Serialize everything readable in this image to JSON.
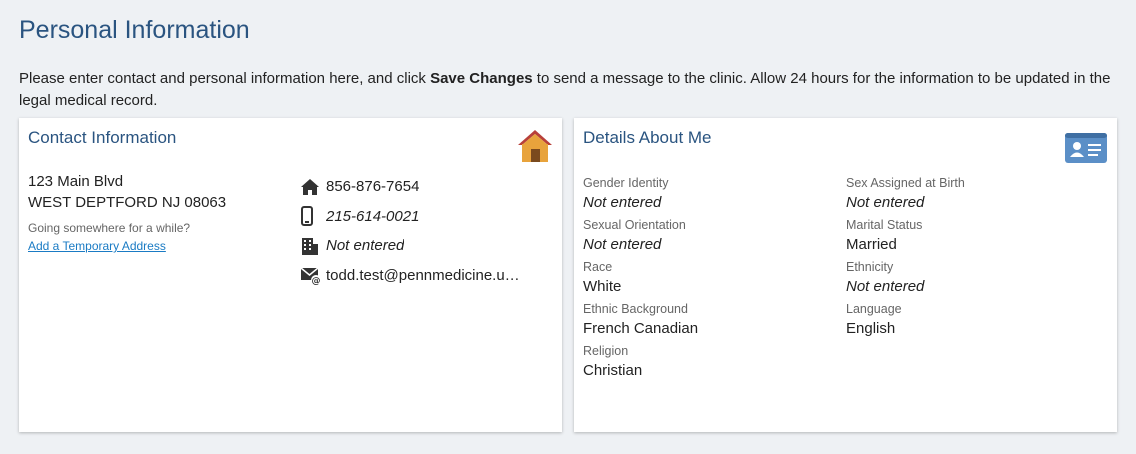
{
  "page": {
    "title": "Personal Information",
    "intro_before": "Please enter contact and personal information here, and click ",
    "intro_bold": "Save Changes",
    "intro_after": " to send a message to the clinic. Allow 24 hours for the information to be updated in the legal medical record."
  },
  "contact": {
    "title": "Contact Information",
    "icon": "house-icon",
    "address_line1": "123 Main Blvd",
    "address_line2": "WEST DEPTFORD NJ 08063",
    "going_text": "Going somewhere for a while?",
    "temp_address_link": "Add a Temporary Address",
    "items": [
      {
        "icon": "home-phone-icon",
        "value": "856-876-7654"
      },
      {
        "icon": "mobile-phone-icon",
        "value": "215-614-0021"
      },
      {
        "icon": "work-phone-icon",
        "value": "Not entered"
      },
      {
        "icon": "email-icon",
        "value": "todd.test@pennmedicine.u…"
      }
    ]
  },
  "details": {
    "title": "Details About Me",
    "icon": "id-card-icon",
    "fields": {
      "gender_identity": {
        "label": "Gender Identity",
        "value": "Not entered"
      },
      "sex_assigned": {
        "label": "Sex Assigned at Birth",
        "value": "Not entered"
      },
      "sexual_orientation": {
        "label": "Sexual Orientation",
        "value": "Not entered"
      },
      "marital_status": {
        "label": "Marital Status",
        "value": "Married"
      },
      "race": {
        "label": "Race",
        "value": "White"
      },
      "ethnicity": {
        "label": "Ethnicity",
        "value": "Not entered"
      },
      "ethnic_background": {
        "label": "Ethnic Background",
        "value": "French Canadian"
      },
      "language": {
        "label": "Language",
        "value": "English"
      },
      "religion": {
        "label": "Religion",
        "value": "Christian"
      }
    }
  },
  "colors": {
    "heading": "#2a5480",
    "link": "#1a7bc4",
    "house_roof": "#c0392b",
    "house_body": "#e8a33c",
    "id_card": "#5b8fc7"
  }
}
